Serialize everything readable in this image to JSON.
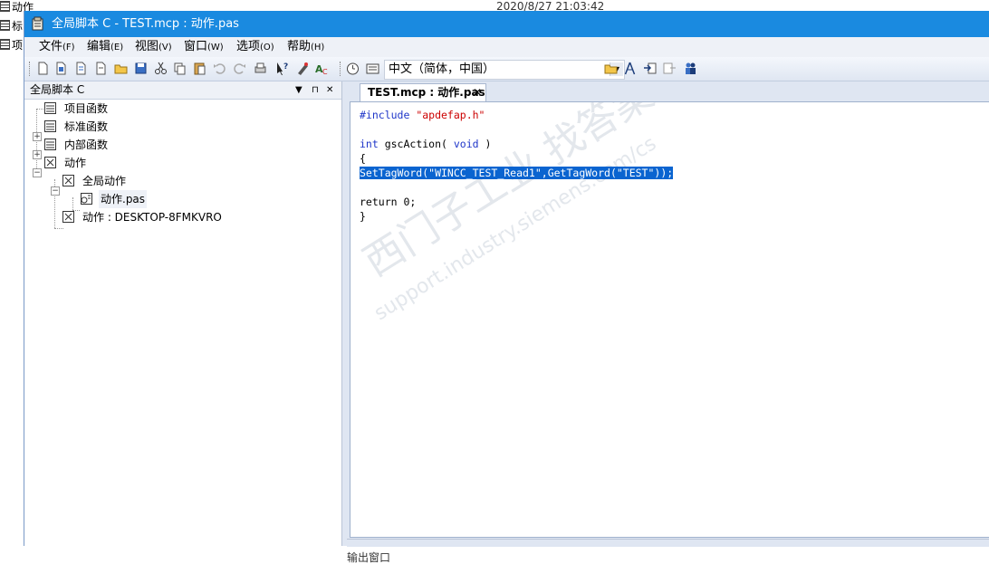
{
  "background": {
    "timestamp": "2020/8/27 21:03:42",
    "desktop_items": [
      "动作",
      "标",
      "项"
    ]
  },
  "window": {
    "title": "全局脚本 C - TEST.mcp : 动作.pas"
  },
  "menu": [
    {
      "label": "文件",
      "accel": "(F)"
    },
    {
      "label": "编辑",
      "accel": "(E)"
    },
    {
      "label": "视图",
      "accel": "(V)"
    },
    {
      "label": "窗口",
      "accel": "(W)"
    },
    {
      "label": "选项",
      "accel": "(O)"
    },
    {
      "label": "帮助",
      "accel": "(H)"
    }
  ],
  "toolbar": {
    "language_value": "中文（简体，中国）"
  },
  "left_pane": {
    "title": "全局脚本 C",
    "dropdown_glyph": "▼",
    "pin_glyph": "⊓",
    "close_glyph": "✕",
    "tree": {
      "project_functions": "项目函数",
      "standard_functions": "标准函数",
      "internal_functions": "内部函数",
      "actions": "动作",
      "global_actions": "全局动作",
      "action_file": "动作.pas",
      "local_actions": "动作 : DESKTOP-8FMKVRO"
    }
  },
  "editor": {
    "tab_label": "TEST.mcp : 动作.pas",
    "tab_close": "✕",
    "code": {
      "line1_directive": "#include ",
      "line1_string": "\"apdefap.h\"",
      "line3_kw1": "int",
      "line3_mid": " gscAction( ",
      "line3_kw2": "void",
      "line3_end": " )",
      "line4": "{",
      "line5_selected": "SetTagWord(\"WINCC_TEST_Read1\",GetTagWord(\"TEST\"));",
      "line7": "return 0;",
      "line8": "}"
    },
    "watermark_cn": "西门子工业   找答案",
    "watermark_url": "support.industry.siemens.com/cs",
    "output_label": "输出窗口"
  },
  "colors": {
    "titlebar": "#1a8ae0",
    "selection": "#0a64d0",
    "keyword": "#1f36c9",
    "string": "#cc0000"
  }
}
